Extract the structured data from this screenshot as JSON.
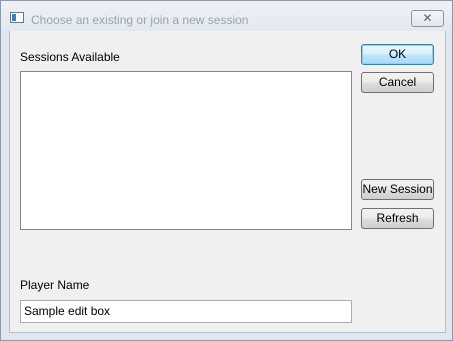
{
  "window": {
    "title": "Choose an existing or join a new session",
    "close_glyph": "✕"
  },
  "sessions": {
    "label": "Sessions Available",
    "items": []
  },
  "buttons": {
    "ok": "OK",
    "cancel": "Cancel",
    "new_session": "New Session",
    "refresh": "Refresh"
  },
  "player": {
    "label": "Player Name",
    "value": "Sample edit box"
  },
  "icons": {
    "app": "app-window-icon",
    "close": "close-icon"
  }
}
